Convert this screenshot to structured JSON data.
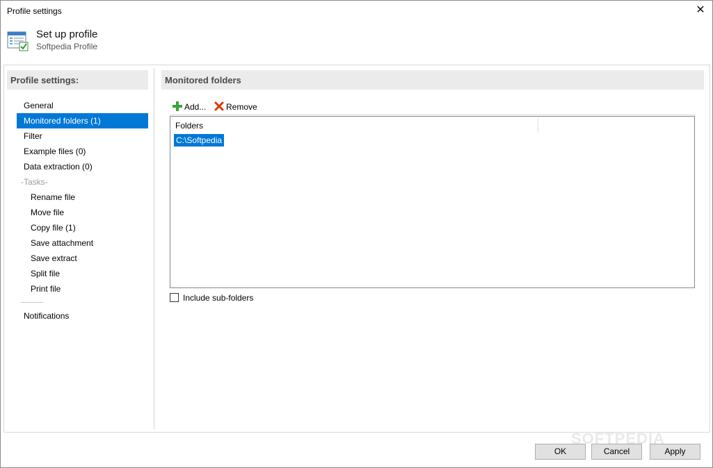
{
  "window": {
    "title": "Profile settings"
  },
  "header": {
    "title": "Set up profile",
    "subtitle": "Softpedia Profile"
  },
  "left": {
    "heading": "Profile settings:",
    "items": [
      {
        "label": "General"
      },
      {
        "label": "Monitored folders (1)",
        "selected": true
      },
      {
        "label": "Filter"
      },
      {
        "label": "Example files (0)"
      },
      {
        "label": "Data extraction (0)"
      }
    ],
    "tasks_group": "-Tasks-",
    "tasks": [
      {
        "label": "Rename file"
      },
      {
        "label": "Move file"
      },
      {
        "label": "Copy file (1)"
      },
      {
        "label": "Save attachment"
      },
      {
        "label": "Save extract"
      },
      {
        "label": "Split file"
      },
      {
        "label": "Print file"
      }
    ],
    "notifications": "Notifications"
  },
  "main": {
    "heading": "Monitored folders",
    "toolbar": {
      "add_label": "Add...",
      "remove_label": "Remove"
    },
    "folders_column": "Folders",
    "folders": [
      "C:\\Softpedia"
    ],
    "include_subfolders": {
      "label": "Include sub-folders",
      "checked": false
    }
  },
  "buttons": {
    "ok": "OK",
    "cancel": "Cancel",
    "apply": "Apply"
  },
  "watermark": "SOFTPEDIA",
  "colors": {
    "accent": "#0078d7",
    "add_icon": "#3aa33a",
    "remove_icon": "#d83b01"
  },
  "icons": [
    "profile-window-icon",
    "add-icon",
    "remove-icon",
    "close-icon"
  ]
}
